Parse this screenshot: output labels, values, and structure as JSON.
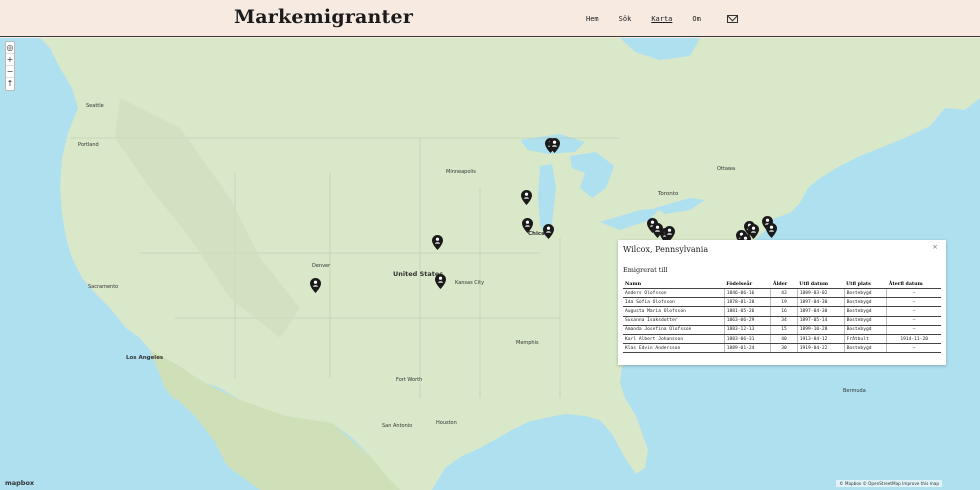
{
  "header": {
    "site_title": "Markemigranter",
    "nav": [
      {
        "label": "Hem",
        "active": false
      },
      {
        "label": "Sök",
        "active": false
      },
      {
        "label": "Karta",
        "active": true
      },
      {
        "label": "Om",
        "active": false
      }
    ],
    "contact_icon": "mail-icon"
  },
  "map": {
    "zoom_in": "+",
    "zoom_out": "−",
    "compass": "↑",
    "locate_icon": "locate-icon",
    "places": {
      "united_states": "United States",
      "los_angeles": "Los Angeles",
      "chicago": "Chicago",
      "toronto": "Toronto",
      "ottawa": "Ottawa",
      "denver": "Denver",
      "minneapolis": "Minneapolis",
      "kansas_city": "Kansas City",
      "memphis": "Memphis",
      "fort_worth": "Fort Worth",
      "san_antonio": "San Antonio",
      "houston": "Houston",
      "bermuda": "Bermuda",
      "sacramento": "Sacramento",
      "portland": "Portland",
      "seattle": "Seattle"
    },
    "attribution": "© Mapbox © OpenStreetMap Improve this map",
    "logo": "mapbox"
  },
  "popup": {
    "title": "Wilcox, Pennsylvania",
    "close": "×",
    "subtitle": "Emigrerat till",
    "columns": [
      "Namn",
      "Födelseår",
      "Ålder",
      "Utfl datum",
      "Utfl plats",
      "Återfl datum"
    ],
    "rows": [
      [
        "Anders Olofsson",
        "1846-06-16",
        "43",
        "1889-03-02",
        "Bostebygd",
        "–"
      ],
      [
        "Ida Sofia Olofsson",
        "1878-01-28",
        "19",
        "1897-04-30",
        "Bostebygd",
        "–"
      ],
      [
        "Augusta Maria Olofsson",
        "1881-05-26",
        "16",
        "1897-04-30",
        "Bostebygd",
        "–"
      ],
      [
        "Susanna Isaksdotter",
        "1863-06-29",
        "34",
        "1897-05-14",
        "Bostebygd",
        "–"
      ],
      [
        "Amanda Josefina Olofsson",
        "1883-12-13",
        "15",
        "1899-10-28",
        "Bostebygd",
        "–"
      ],
      [
        "Karl Albert Johansson",
        "1883-06-31",
        "40",
        "1913-04-12",
        "Fråtbult",
        "1914-11-20"
      ],
      [
        "Klas Edvin Andersson",
        "1889-01-24",
        "30",
        "1919-04-22",
        "Bostebygd",
        "–"
      ]
    ]
  },
  "colors": {
    "header_bg": "#f7ebe1",
    "land": "#d9e8c9",
    "water": "#aee0f0",
    "marker": "#1a1a1a"
  }
}
